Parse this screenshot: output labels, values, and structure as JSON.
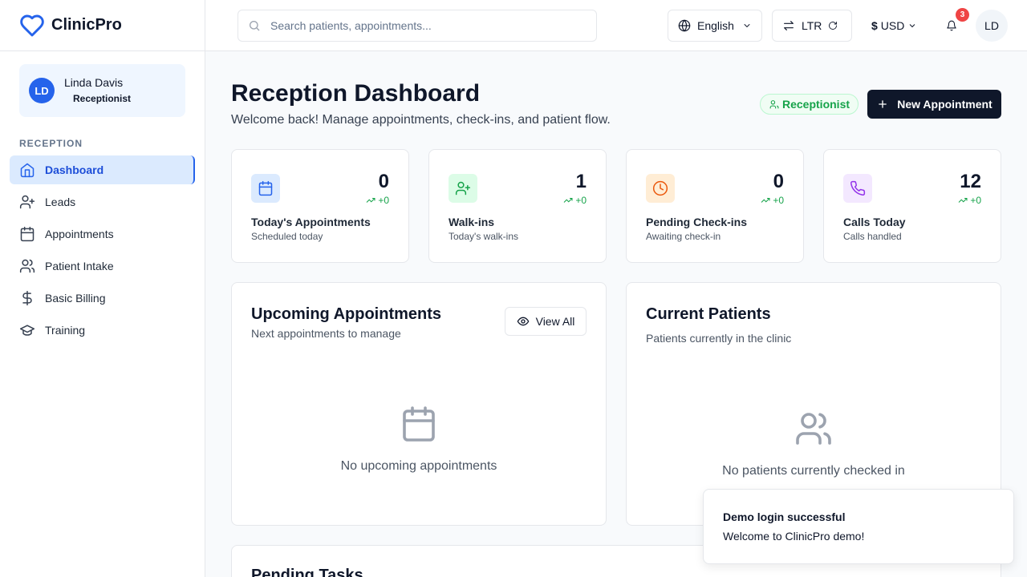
{
  "brand": {
    "name": "ClinicPro",
    "icon": "heart-icon",
    "color": "#2563eb"
  },
  "user": {
    "initials": "LD",
    "name": "Linda Davis",
    "role": "Receptionist"
  },
  "sidebar": {
    "section_label": "RECEPTION",
    "items": [
      {
        "label": "Dashboard",
        "icon": "home-icon",
        "active": true
      },
      {
        "label": "Leads",
        "icon": "user-plus-icon"
      },
      {
        "label": "Appointments",
        "icon": "calendar-icon"
      },
      {
        "label": "Patient Intake",
        "icon": "users-icon"
      },
      {
        "label": "Basic Billing",
        "icon": "dollar-icon"
      },
      {
        "label": "Training",
        "icon": "graduation-cap-icon"
      }
    ]
  },
  "header": {
    "search_placeholder": "Search patients, appointments...",
    "language": "English",
    "direction": "LTR",
    "currency_symbol": "$",
    "currency": "USD",
    "notification_count": "3",
    "avatar_initials": "LD"
  },
  "page": {
    "title": "Reception Dashboard",
    "subtitle": "Welcome back! Manage appointments, check-ins, and patient flow.",
    "role_badge": "Receptionist",
    "new_button": "New Appointment"
  },
  "stats": [
    {
      "value": "0",
      "trend": "+0",
      "title": "Today's Appointments",
      "subtitle": "Scheduled today",
      "icon": "calendar-icon",
      "bg": "#dbeafe",
      "color": "#2563eb"
    },
    {
      "value": "1",
      "trend": "+0",
      "title": "Walk-ins",
      "subtitle": "Today's walk-ins",
      "icon": "user-plus-icon",
      "bg": "#dcfce7",
      "color": "#16a34a"
    },
    {
      "value": "0",
      "trend": "+0",
      "title": "Pending Check-ins",
      "subtitle": "Awaiting check-in",
      "icon": "clock-icon",
      "bg": "#ffedd5",
      "color": "#ea580c"
    },
    {
      "value": "12",
      "trend": "+0",
      "title": "Calls Today",
      "subtitle": "Calls handled",
      "icon": "phone-icon",
      "bg": "#f3e8ff",
      "color": "#9333ea"
    }
  ],
  "upcoming": {
    "title": "Upcoming Appointments",
    "subtitle": "Next appointments to manage",
    "view_all": "View All",
    "empty": "No upcoming appointments"
  },
  "current": {
    "title": "Current Patients",
    "subtitle": "Patients currently in the clinic",
    "empty": "No patients currently checked in"
  },
  "pending": {
    "title": "Pending Tasks"
  },
  "toast": {
    "title": "Demo login successful",
    "message": "Welcome to ClinicPro demo!"
  }
}
